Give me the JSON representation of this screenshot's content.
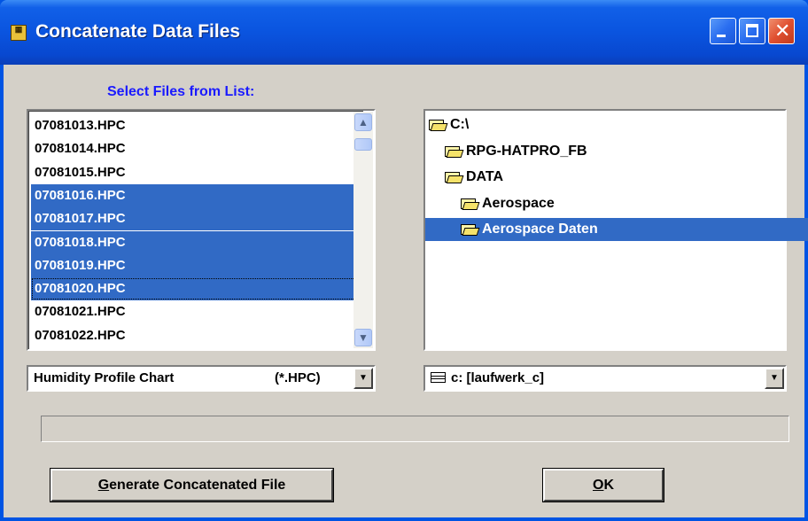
{
  "window": {
    "title": "Concatenate Data Files",
    "app_icon": "rpg-app-icon"
  },
  "file_panel": {
    "label": "Select Files from List:",
    "files": [
      {
        "name": "07081013.HPC",
        "selected": false
      },
      {
        "name": "07081014.HPC",
        "selected": false
      },
      {
        "name": "07081015.HPC",
        "selected": false
      },
      {
        "name": "07081016.HPC",
        "selected": true
      },
      {
        "name": "07081017.HPC",
        "selected": true
      },
      {
        "name": "07081018.HPC",
        "selected": true
      },
      {
        "name": "07081019.HPC",
        "selected": true
      },
      {
        "name": "07081020.HPC",
        "selected": true,
        "focused": true
      },
      {
        "name": "07081021.HPC",
        "selected": false
      },
      {
        "name": "07081022.HPC",
        "selected": false
      }
    ],
    "filter_type": "Humidity Profile Chart",
    "filter_ext": "(*.HPC)"
  },
  "folder_panel": {
    "folders": [
      {
        "name": "C:\\",
        "selected": false,
        "open": true
      },
      {
        "name": "RPG-HATPRO_FB",
        "selected": false,
        "open": true
      },
      {
        "name": "DATA",
        "selected": false,
        "open": true
      },
      {
        "name": "Aerospace",
        "selected": false,
        "open": true
      },
      {
        "name": "Aerospace Daten",
        "selected": true,
        "open": true
      }
    ],
    "drive": "c: [laufwerk_c]"
  },
  "progress": {
    "value": 0
  },
  "buttons": {
    "generate_prefix": "G",
    "generate_rest": "enerate Concatenated File",
    "ok_prefix": "O",
    "ok_rest": "K"
  },
  "colors": {
    "selection": "#316ac5",
    "label": "#1a1aff",
    "titlebar": "#0a54df"
  }
}
